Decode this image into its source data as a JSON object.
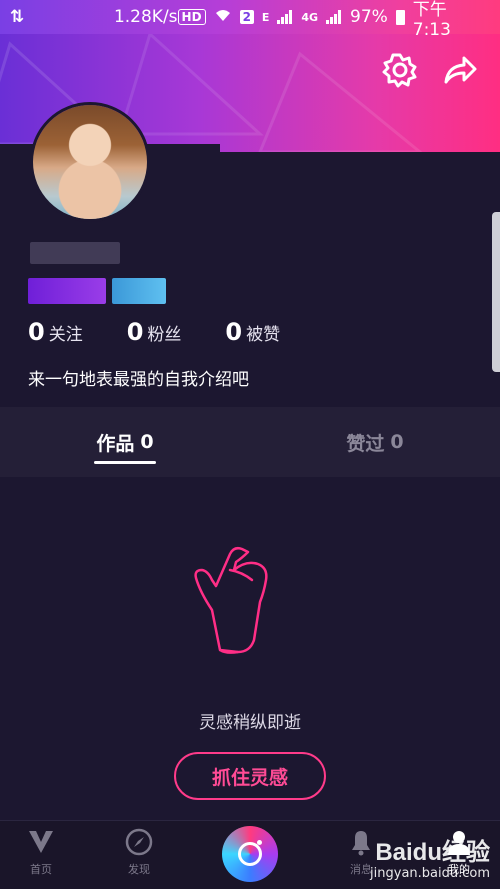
{
  "status_bar": {
    "speed": "1.28K/s",
    "hd": "HD",
    "sim_badge": "2",
    "network_e": "E",
    "network_4g": "4G",
    "battery": "97%",
    "time": "下午 7:13"
  },
  "stats": [
    {
      "num": "0",
      "label": "关注"
    },
    {
      "num": "0",
      "label": "粉丝"
    },
    {
      "num": "0",
      "label": "被赞"
    }
  ],
  "bio": "来一句地表最强的自我介绍吧",
  "tabs": {
    "works_label": "作品",
    "works_count": "0",
    "liked_label": "赞过",
    "liked_count": "0"
  },
  "empty": {
    "text": "灵感稍纵即逝",
    "cta": "抓住灵感"
  },
  "nav": {
    "home": "首页",
    "discover": "发现",
    "messages": "消息",
    "me": "我的"
  },
  "watermark": {
    "brand": "Baidu经验",
    "url": "jingyan.baidu.com"
  },
  "colors": {
    "accent_pink": "#ff3b8a",
    "gradient_start": "#6a2fd6",
    "gradient_end": "#ff2e82",
    "background": "#1c1730"
  }
}
